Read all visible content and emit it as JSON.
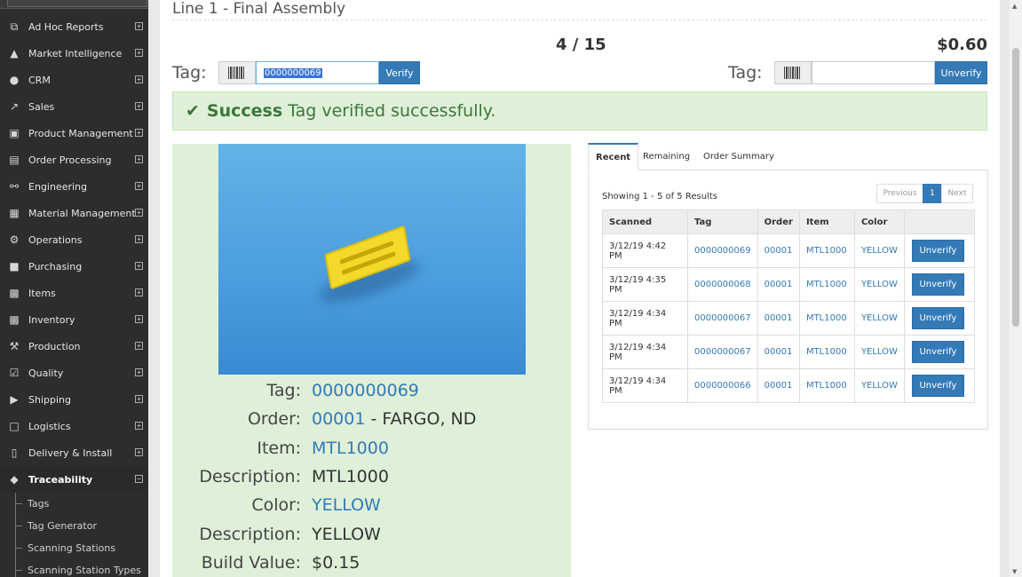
{
  "sidebar": {
    "items": [
      {
        "label": "Ad Hoc Reports",
        "icon": "reports-icon",
        "glyph": "⧉",
        "toggle": "+"
      },
      {
        "label": "Market Intelligence",
        "icon": "graduation-cap-icon",
        "glyph": "▲",
        "toggle": "+"
      },
      {
        "label": "CRM",
        "icon": "user-icon",
        "glyph": "●",
        "toggle": "+"
      },
      {
        "label": "Sales",
        "icon": "line-chart-icon",
        "glyph": "↗",
        "toggle": "+"
      },
      {
        "label": "Product Management",
        "icon": "cube-icon",
        "glyph": "▣",
        "toggle": "+"
      },
      {
        "label": "Order Processing",
        "icon": "documents-icon",
        "glyph": "▤",
        "toggle": "+"
      },
      {
        "label": "Engineering",
        "icon": "engineering-icon",
        "glyph": "⚯",
        "toggle": "+"
      },
      {
        "label": "Material Management",
        "icon": "factory-icon",
        "glyph": "▦",
        "toggle": "+"
      },
      {
        "label": "Operations",
        "icon": "gears-icon",
        "glyph": "⚙",
        "toggle": "+"
      },
      {
        "label": "Purchasing",
        "icon": "cart-icon",
        "glyph": "■",
        "toggle": "+"
      },
      {
        "label": "Items",
        "icon": "cubes-icon",
        "glyph": "▩",
        "toggle": "+"
      },
      {
        "label": "Inventory",
        "icon": "boxes-icon",
        "glyph": "▩",
        "toggle": "+"
      },
      {
        "label": "Production",
        "icon": "wrench-icon",
        "glyph": "⚒",
        "toggle": "+"
      },
      {
        "label": "Quality",
        "icon": "checkbox-icon",
        "glyph": "☑",
        "toggle": "+"
      },
      {
        "label": "Shipping",
        "icon": "truck-icon",
        "glyph": "▶",
        "toggle": "+"
      },
      {
        "label": "Logistics",
        "icon": "calendar-check-icon",
        "glyph": "□",
        "toggle": "+"
      },
      {
        "label": "Delivery & Install",
        "icon": "building-icon",
        "glyph": "▯",
        "toggle": "+"
      },
      {
        "label": "Traceability",
        "icon": "tags-icon",
        "glyph": "◆",
        "toggle": "−"
      }
    ],
    "subitems": [
      {
        "label": "Tags"
      },
      {
        "label": "Tag Generator"
      },
      {
        "label": "Scanning Stations"
      },
      {
        "label": "Scanning Station Types"
      }
    ]
  },
  "header": {
    "title": "Line 1 - Final Assembly",
    "counter": "4 / 15",
    "price": "$0.60"
  },
  "verify": {
    "label": "Tag:",
    "input_value": "0000000069",
    "button": "Verify"
  },
  "unverify": {
    "label": "Tag:",
    "input_value": "",
    "button": "Unverify"
  },
  "alert": {
    "strong": "Success",
    "message": "Tag verified successfully."
  },
  "details": {
    "rows": [
      {
        "label": "Tag:",
        "value": "0000000069",
        "suffix": "",
        "link": true
      },
      {
        "label": "Order:",
        "value": "00001",
        "suffix": " - FARGO, ND",
        "link": true
      },
      {
        "label": "Item:",
        "value": "MTL1000",
        "suffix": "",
        "link": true
      },
      {
        "label": "Description:",
        "value": "MTL1000",
        "suffix": "",
        "link": false
      },
      {
        "label": "Color:",
        "value": "YELLOW",
        "suffix": "",
        "link": true
      },
      {
        "label": "Description:",
        "value": "YELLOW",
        "suffix": "",
        "link": false
      },
      {
        "label": "Build Value:",
        "value": "$0.15",
        "suffix": "",
        "link": false
      }
    ]
  },
  "tabs": [
    {
      "label": "Recent",
      "active": true
    },
    {
      "label": "Remaining",
      "active": false
    },
    {
      "label": "Order Summary",
      "active": false
    }
  ],
  "results": {
    "text": "Showing 1 - 5 of 5 Results",
    "pager": {
      "previous": "Previous",
      "page": "1",
      "next": "Next"
    }
  },
  "table": {
    "headers": [
      "Scanned",
      "Tag",
      "Order",
      "Item",
      "Color",
      ""
    ],
    "rows": [
      {
        "scanned": "3/12/19 4:42 PM",
        "tag": "0000000069",
        "order": "00001",
        "item": "MTL1000",
        "color": "YELLOW",
        "action": "Unverify"
      },
      {
        "scanned": "3/12/19 4:35 PM",
        "tag": "0000000068",
        "order": "00001",
        "item": "MTL1000",
        "color": "YELLOW",
        "action": "Unverify"
      },
      {
        "scanned": "3/12/19 4:34 PM",
        "tag": "0000000067",
        "order": "00001",
        "item": "MTL1000",
        "color": "YELLOW",
        "action": "Unverify"
      },
      {
        "scanned": "3/12/19 4:34 PM",
        "tag": "0000000067",
        "order": "00001",
        "item": "MTL1000",
        "color": "YELLOW",
        "action": "Unverify"
      },
      {
        "scanned": "3/12/19 4:34 PM",
        "tag": "0000000066",
        "order": "00001",
        "item": "MTL1000",
        "color": "YELLOW",
        "action": "Unverify"
      }
    ]
  },
  "colors": {
    "accent": "#337ab7",
    "success_bg": "#dff0d8",
    "success_text": "#3c763d",
    "sidebar_bg": "#2d2d2d"
  }
}
